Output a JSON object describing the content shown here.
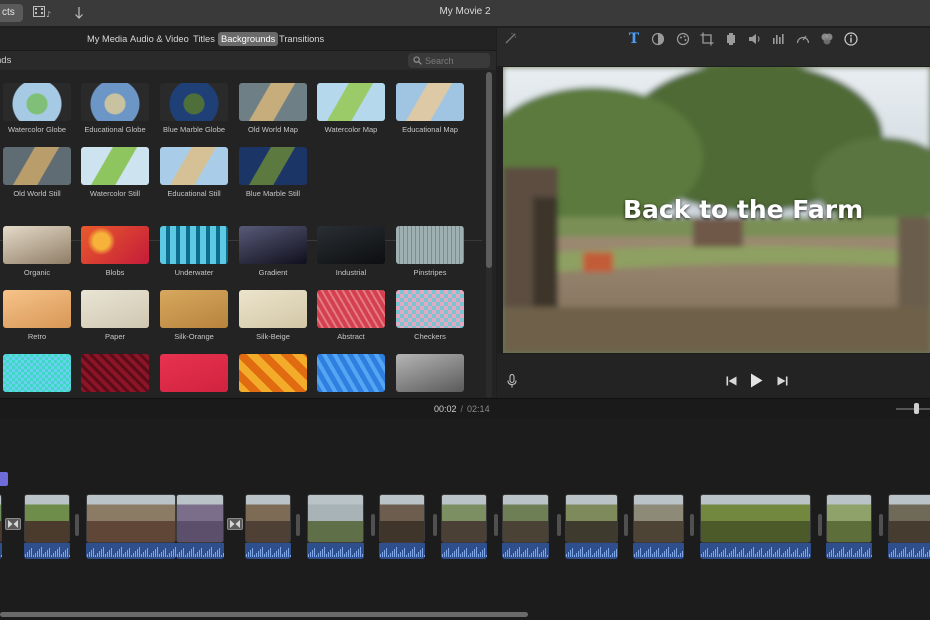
{
  "window": {
    "title": "My Movie 2",
    "projects_label": "cts"
  },
  "browser": {
    "tabs": [
      {
        "label": "My Media",
        "active": false
      },
      {
        "label": "Audio & Video",
        "active": false
      },
      {
        "label": "Titles",
        "active": false
      },
      {
        "label": "Backgrounds",
        "active": true
      },
      {
        "label": "Transitions",
        "active": false
      }
    ],
    "section_label": "nds",
    "search_placeholder": "Search",
    "items": [
      {
        "label": "Watercolor Globe",
        "icon": "globe-icon",
        "colors": [
          "#a6c9e4",
          "#7fbf77"
        ]
      },
      {
        "label": "Educational Globe",
        "icon": "globe-icon",
        "colors": [
          "#6b96c6",
          "#c9c2a0"
        ]
      },
      {
        "label": "Blue Marble Globe",
        "icon": "globe-icon",
        "colors": [
          "#1f3f77",
          "#4e6f3a"
        ]
      },
      {
        "label": "Old World Map",
        "icon": "map-icon",
        "colors": [
          "#6e7f86",
          "#c7ad7b"
        ]
      },
      {
        "label": "Watercolor Map",
        "icon": "map-icon",
        "colors": [
          "#b6d8ec",
          "#9bcb69"
        ]
      },
      {
        "label": "Educational Map",
        "icon": "map-icon",
        "colors": [
          "#9fc5e3",
          "#ddc9a6"
        ]
      },
      {
        "label": "Old World Still",
        "icon": "map-icon",
        "colors": [
          "#5f6c74",
          "#b99e6c"
        ]
      },
      {
        "label": "Watercolor Still",
        "icon": "map-icon",
        "colors": [
          "#cde3ef",
          "#8ec55e"
        ]
      },
      {
        "label": "Educational Still",
        "icon": "map-icon",
        "colors": [
          "#a9cde8",
          "#d5c195"
        ]
      },
      {
        "label": "Blue Marble Still",
        "icon": "map-icon",
        "colors": [
          "#1b3566",
          "#5c7a3f"
        ]
      },
      {
        "label": "Organic",
        "icon": "texture-icon",
        "colors": [
          "#e5dbc9",
          "#8f7d66"
        ]
      },
      {
        "label": "Blobs",
        "icon": "texture-icon",
        "colors": [
          "#e85a2c",
          "#c51c3a"
        ]
      },
      {
        "label": "Underwater",
        "icon": "texture-icon",
        "colors": [
          "#5ec9e2",
          "#0e6c8d"
        ]
      },
      {
        "label": "Gradient",
        "icon": "texture-icon",
        "colors": [
          "#585a78",
          "#0f0f1c"
        ]
      },
      {
        "label": "Industrial",
        "icon": "texture-icon",
        "colors": [
          "#2a2f34",
          "#0c0e10"
        ]
      },
      {
        "label": "Pinstripes",
        "icon": "texture-icon",
        "colors": [
          "#9fb0b3",
          "#7d8c90"
        ]
      },
      {
        "label": "Retro",
        "icon": "texture-icon",
        "colors": [
          "#f6c38a",
          "#d89755"
        ]
      },
      {
        "label": "Paper",
        "icon": "texture-icon",
        "colors": [
          "#e9e4d4",
          "#cfc7b1"
        ]
      },
      {
        "label": "Silk-Orange",
        "icon": "texture-icon",
        "colors": [
          "#d8a85e",
          "#b7833d"
        ]
      },
      {
        "label": "Silk-Beige",
        "icon": "texture-icon",
        "colors": [
          "#ece4cc",
          "#d2c7a6"
        ]
      },
      {
        "label": "Abstract",
        "icon": "texture-icon",
        "colors": [
          "#d5404f",
          "#e47a85"
        ]
      },
      {
        "label": "Checkers",
        "icon": "texture-icon",
        "colors": [
          "#79c6d1",
          "#e6a9c4"
        ]
      },
      {
        "label": "",
        "icon": "texture-icon",
        "colors": [
          "#3ed8c5",
          "#6ad0f0"
        ]
      },
      {
        "label": "",
        "icon": "texture-icon",
        "colors": [
          "#8b1426",
          "#5c0c18"
        ]
      },
      {
        "label": "",
        "icon": "texture-icon",
        "colors": [
          "#e83250",
          "#d0233f"
        ]
      },
      {
        "label": "",
        "icon": "texture-icon",
        "colors": [
          "#f3ac2a",
          "#e06b11"
        ]
      },
      {
        "label": "",
        "icon": "texture-icon",
        "colors": [
          "#2e7fe0",
          "#54a6f3"
        ]
      },
      {
        "label": "",
        "icon": "texture-icon",
        "colors": [
          "#b5b5b5",
          "#5a5a5a"
        ]
      }
    ]
  },
  "viewer": {
    "video_title": "Back to the Farm"
  },
  "timeline": {
    "current_time": "00:02",
    "separator": "/",
    "total_time": "02:14"
  }
}
